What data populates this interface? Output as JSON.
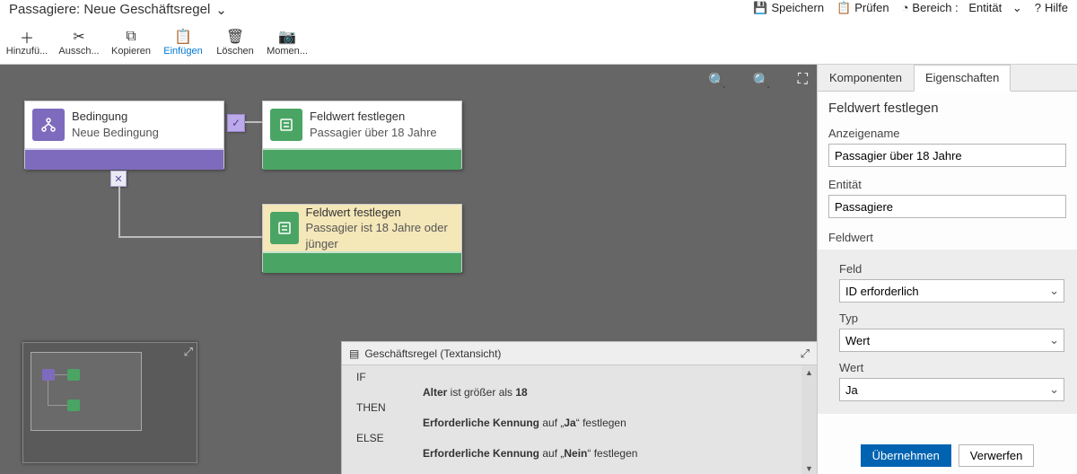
{
  "header": {
    "title": "Passagiere: Neue Geschäftsregel",
    "save": "Speichern",
    "validate": "Prüfen",
    "scope_label": "Bereich :",
    "scope_value": "Entität",
    "help": "Hilfe"
  },
  "toolbar": {
    "add": "Hinzufü...",
    "cut": "Aussch...",
    "copy": "Kopieren",
    "paste": "Einfügen",
    "delete": "Löschen",
    "snapshot": "Momen..."
  },
  "canvas": {
    "condition": {
      "title": "Bedingung",
      "subtitle": "Neue Bedingung"
    },
    "action1": {
      "title": "Feldwert festlegen",
      "subtitle": "Passagier über 18 Jahre"
    },
    "action2": {
      "title": "Feldwert festlegen",
      "subtitle": "Passagier ist 18 Jahre oder jünger"
    }
  },
  "textview": {
    "title": "Geschäftsregel (Textansicht)",
    "if_kw": "IF",
    "if_body_pre": "Alter",
    "if_body_mid": " ist größer als ",
    "if_body_post": "18",
    "then_kw": "THEN",
    "then_body_pre": "Erforderliche Kennung",
    "then_body_mid": " auf „",
    "then_body_val": "Ja",
    "then_body_post": "“ festlegen",
    "else_kw": "ELSE",
    "else_body_pre": "Erforderliche Kennung",
    "else_body_mid": " auf „",
    "else_body_val": "Nein",
    "else_body_post": "“ festlegen"
  },
  "side": {
    "tab1": "Komponenten",
    "tab2": "Eigenschaften",
    "title": "Feldwert festlegen",
    "display_name_label": "Anzeigename",
    "display_name_value": "Passagier über 18 Jahre",
    "entity_label": "Entität",
    "entity_value": "Passagiere",
    "fieldvalue_label": "Feldwert",
    "field_label": "Feld",
    "field_value": "ID erforderlich",
    "type_label": "Typ",
    "type_value": "Wert",
    "value_label": "Wert",
    "value_value": "Ja",
    "apply": "Übernehmen",
    "discard": "Verwerfen"
  }
}
